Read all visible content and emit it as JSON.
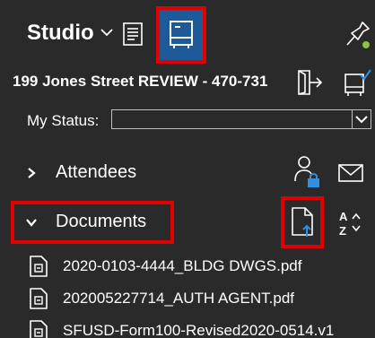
{
  "header": {
    "workspace_label": "Studio",
    "icons": [
      "chevron-down-icon",
      "list-icon",
      "session-tray-icon",
      "pin-icon"
    ]
  },
  "project": {
    "title": "199 Jones Street REVIEW - 470-731",
    "icons": [
      "exit-icon",
      "sync-icon"
    ]
  },
  "status": {
    "label": "My Status:",
    "value": ""
  },
  "sections": {
    "attendees": {
      "label": "Attendees",
      "icons": [
        "user-lock-icon",
        "mail-icon"
      ]
    },
    "documents": {
      "label": "Documents",
      "icons": [
        "upload-document-icon",
        "sort-az-icon"
      ]
    }
  },
  "files": [
    {
      "name": "2020-0103-4444_BLDG DWGS.pdf"
    },
    {
      "name": "202005227714_AUTH AGENT.pdf"
    },
    {
      "name": "SFUSD-Form100-Revised2020-0514.v1"
    }
  ],
  "colors": {
    "background": "#2a2a2a",
    "highlight_border": "#e10000",
    "active_tile": "#1e5a9a",
    "accent_blue": "#2f8fe0",
    "accent_green": "#8bc34a",
    "text": "#ffffff"
  }
}
